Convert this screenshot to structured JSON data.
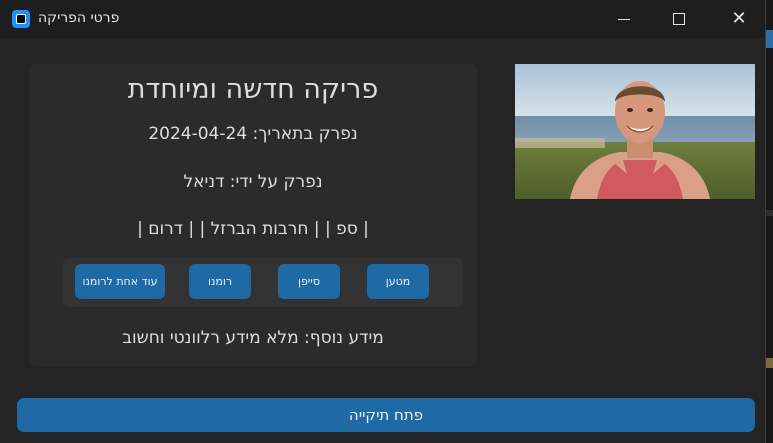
{
  "window": {
    "title": "פרטי הפריקה"
  },
  "card": {
    "title": "פריקה חדשה ומיוחדת",
    "date_line": "נפרק בתאריך: 2024-04-24",
    "author_line": "נפרק על ידי: דניאל",
    "tags_line": "| ספ |  | חרבות הברזל |  | דרום |",
    "info_line": "מידע נוסף: מלא מידע רלוונטי וחשוב"
  },
  "chips": [
    {
      "label": "מטען"
    },
    {
      "label": "סייפן"
    },
    {
      "label": "רומנו"
    },
    {
      "label": "עוד אחת לרומנו"
    }
  ],
  "actions": {
    "open_folder": "פתח תיקייה"
  },
  "colors": {
    "accent": "#1f6aa5",
    "window_bg": "#242424",
    "card_bg": "#2b2b2b",
    "text": "#dedede"
  },
  "icons": [
    "app-icon",
    "minimize-icon",
    "maximize-icon",
    "close-icon"
  ]
}
